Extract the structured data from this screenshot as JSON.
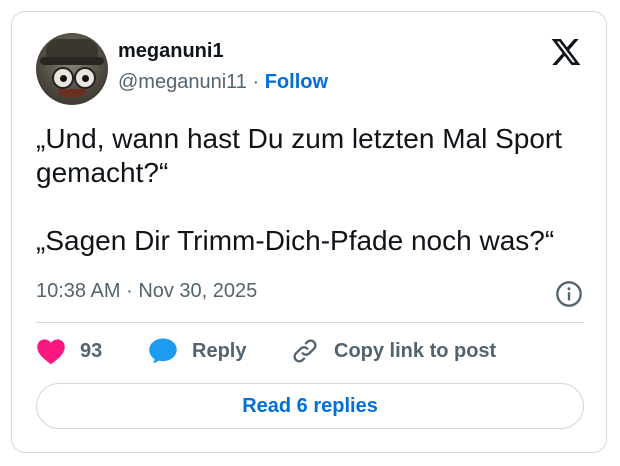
{
  "author": {
    "name": "meganuni1",
    "handle": "@meganuni11",
    "separator": "·",
    "follow_label": "Follow"
  },
  "tweet": {
    "paragraphs": [
      "„Und, wann hast Du zum letzten Mal Sport gemacht?“",
      "„Sagen Dir Trimm-Dich-Pfade noch was?“"
    ],
    "time": "10:38 AM",
    "date_separator": "·",
    "date": "Nov 30, 2025"
  },
  "actions": {
    "like_count": "93",
    "reply_label": "Reply",
    "copy_label": "Copy link to post"
  },
  "read_replies_label": "Read 6 replies",
  "colors": {
    "like": "#f91880",
    "reply": "#1d9bf0",
    "link": "#006fd6",
    "secondary_text": "#536471"
  }
}
